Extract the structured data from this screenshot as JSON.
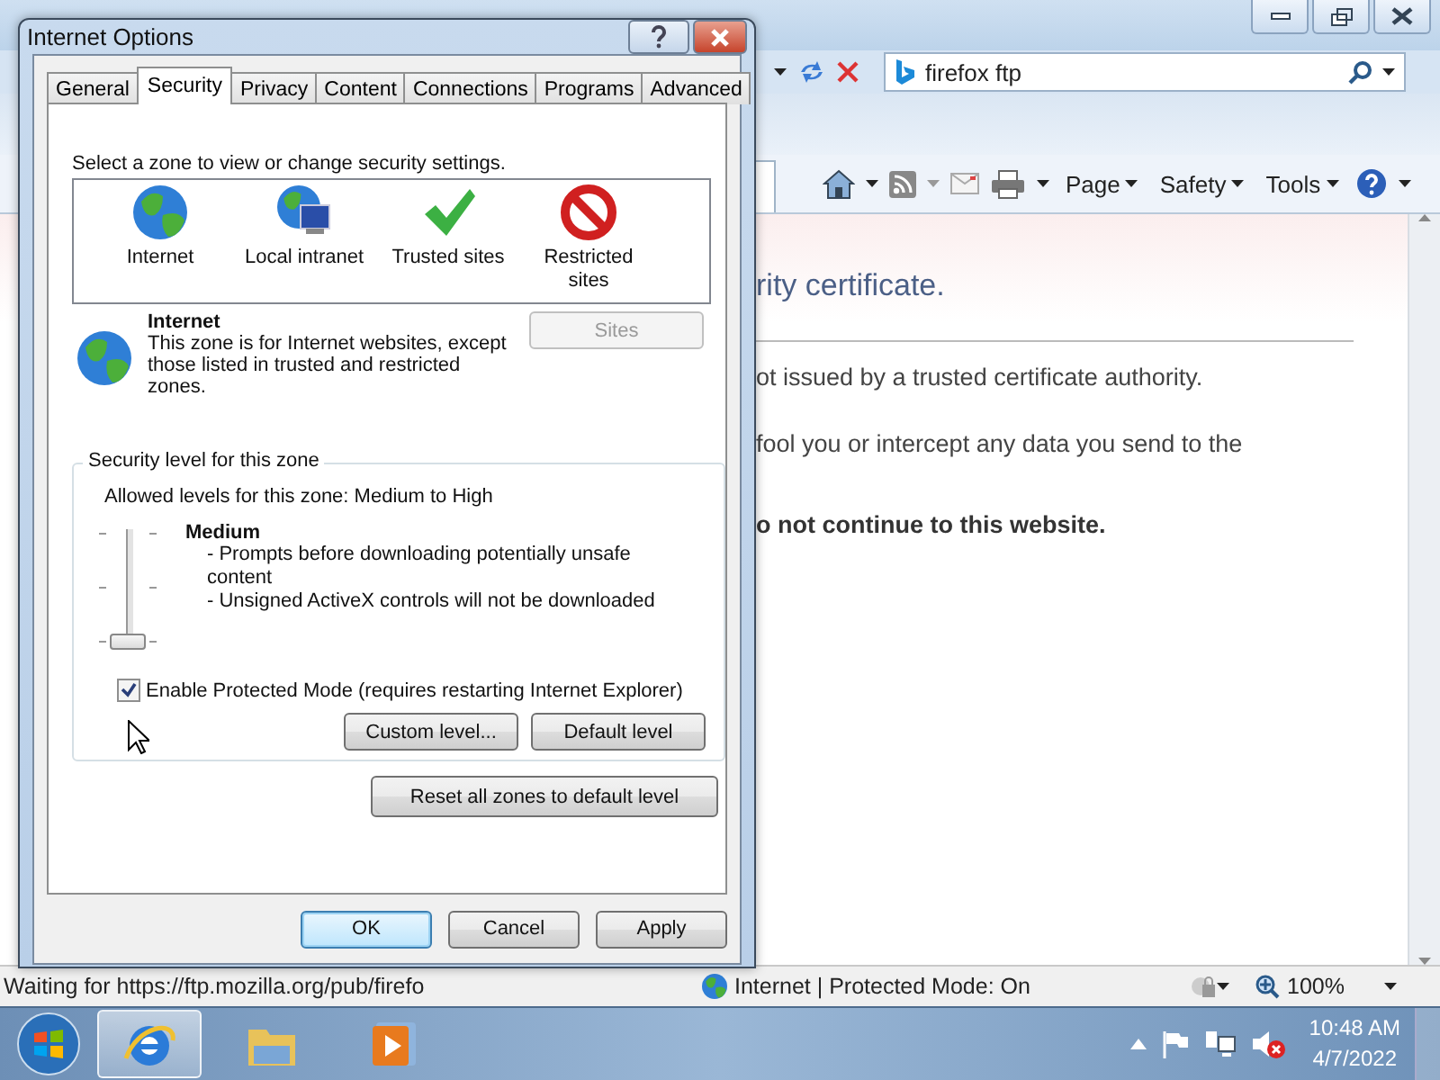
{
  "browser": {
    "search_query": "firefox ftp",
    "command_bar": [
      {
        "label": "Page"
      },
      {
        "label": "Safety"
      },
      {
        "label": "Tools"
      }
    ],
    "content": {
      "heading": "rity certificate.",
      "paragraphs": [
        "ot issued by a trusted certificate authority.",
        "fool you or intercept any data you send to the"
      ],
      "warning": "o not continue to this website."
    },
    "status_bar": {
      "message": "Waiting for https://ftp.mozilla.org/pub/firefo",
      "zone": "Internet | Protected Mode: On",
      "zoom": "100%"
    }
  },
  "dialog": {
    "title": "Internet Options",
    "tabs": [
      {
        "label": "General",
        "selected": false
      },
      {
        "label": "Security",
        "selected": true
      },
      {
        "label": "Privacy",
        "selected": false
      },
      {
        "label": "Content",
        "selected": false
      },
      {
        "label": "Connections",
        "selected": false
      },
      {
        "label": "Programs",
        "selected": false
      },
      {
        "label": "Advanced",
        "selected": false
      }
    ],
    "zone_prompt": "Select a zone to view or change security settings.",
    "zones": [
      {
        "label": "Internet",
        "kind": "internet"
      },
      {
        "label": "Local intranet",
        "kind": "intranet"
      },
      {
        "label": "Trusted sites",
        "kind": "trusted"
      },
      {
        "label": "Restricted sites",
        "kind": "restricted"
      }
    ],
    "zone_info": {
      "name": "Internet",
      "description": "This zone is for Internet websites, except those listed in trusted and restricted zones."
    },
    "sites_button": {
      "label": "Sites",
      "disabled": true
    },
    "security_level": {
      "group_title": "Security level for this zone",
      "allowed": "Allowed levels for this zone: Medium to High",
      "level": 0,
      "level_name": "Medium",
      "details": [
        "- Prompts before downloading potentially unsafe content",
        "- Unsigned ActiveX controls will not be downloaded"
      ],
      "protected_mode": {
        "label": "Enable Protected Mode (requires restarting Internet Explorer)",
        "checked": true
      },
      "buttons": [
        "Custom level...",
        "Default level"
      ]
    },
    "reset_button": "Reset all zones to default level",
    "buttons": [
      {
        "label": "OK",
        "default": true
      },
      {
        "label": "Cancel",
        "default": false
      },
      {
        "label": "Apply",
        "default": false
      }
    ]
  },
  "taskbar": {
    "apps": [
      {
        "kind": "ie",
        "selected": true
      },
      {
        "kind": "explorer",
        "selected": false
      },
      {
        "kind": "media",
        "selected": false
      }
    ],
    "time": "10:48 AM",
    "date": "4/7/2022"
  }
}
